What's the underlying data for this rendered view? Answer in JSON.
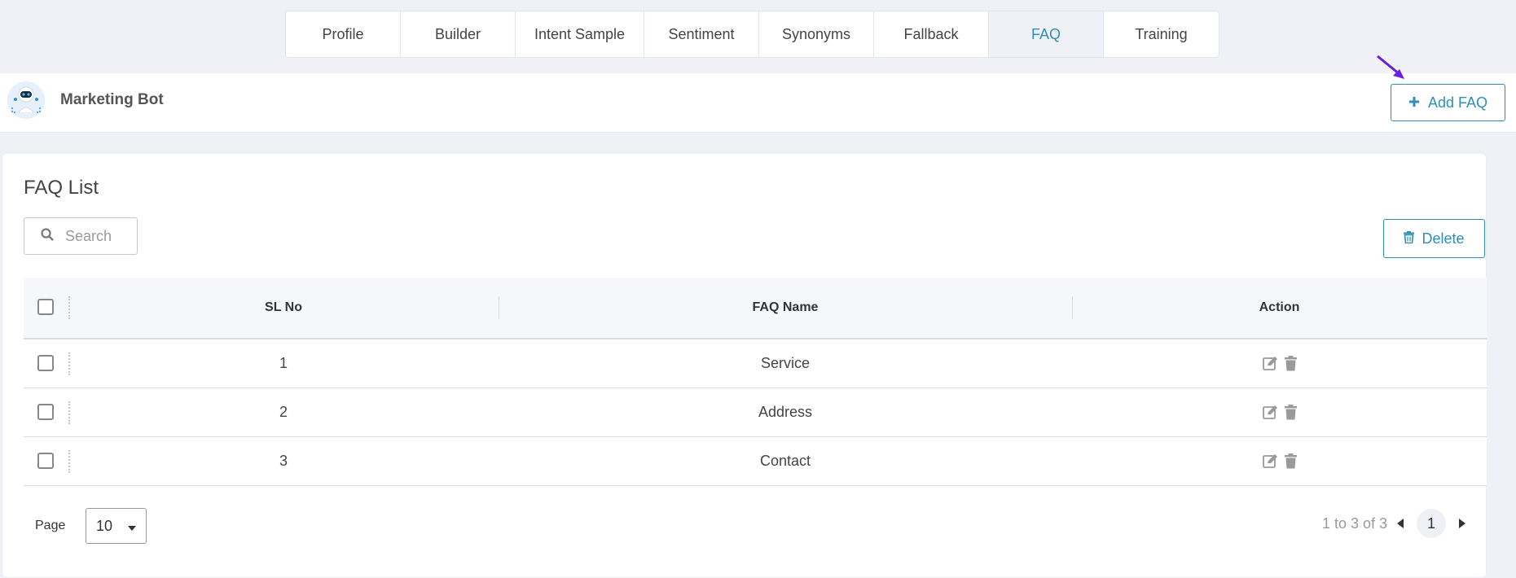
{
  "tabs": [
    {
      "label": "Profile",
      "active": false
    },
    {
      "label": "Builder",
      "active": false
    },
    {
      "label": "Intent Sample",
      "active": false
    },
    {
      "label": "Sentiment",
      "active": false
    },
    {
      "label": "Synonyms",
      "active": false
    },
    {
      "label": "Fallback",
      "active": false
    },
    {
      "label": "FAQ",
      "active": true
    },
    {
      "label": "Training",
      "active": false
    }
  ],
  "header": {
    "bot_name": "Marketing Bot",
    "add_label": "Add FAQ",
    "avatar_icon": "robot-avatar-icon",
    "pointer_icon": "arrow-pointer-icon"
  },
  "main": {
    "title": "FAQ List",
    "search_placeholder": "Search",
    "delete_label": "Delete"
  },
  "table": {
    "columns": [
      "SL No",
      "FAQ Name",
      "Action"
    ],
    "rows": [
      {
        "sl": "1",
        "name": "Service"
      },
      {
        "sl": "2",
        "name": "Address"
      },
      {
        "sl": "3",
        "name": "Contact"
      }
    ]
  },
  "footer": {
    "page_label": "Page",
    "page_size": "10",
    "range_text": "1 to 3 of 3",
    "current_page": "1"
  },
  "colors": {
    "accent": "#2e8fb5",
    "pointer": "#6a1ee0",
    "icon_gray": "#9a9a9a"
  }
}
